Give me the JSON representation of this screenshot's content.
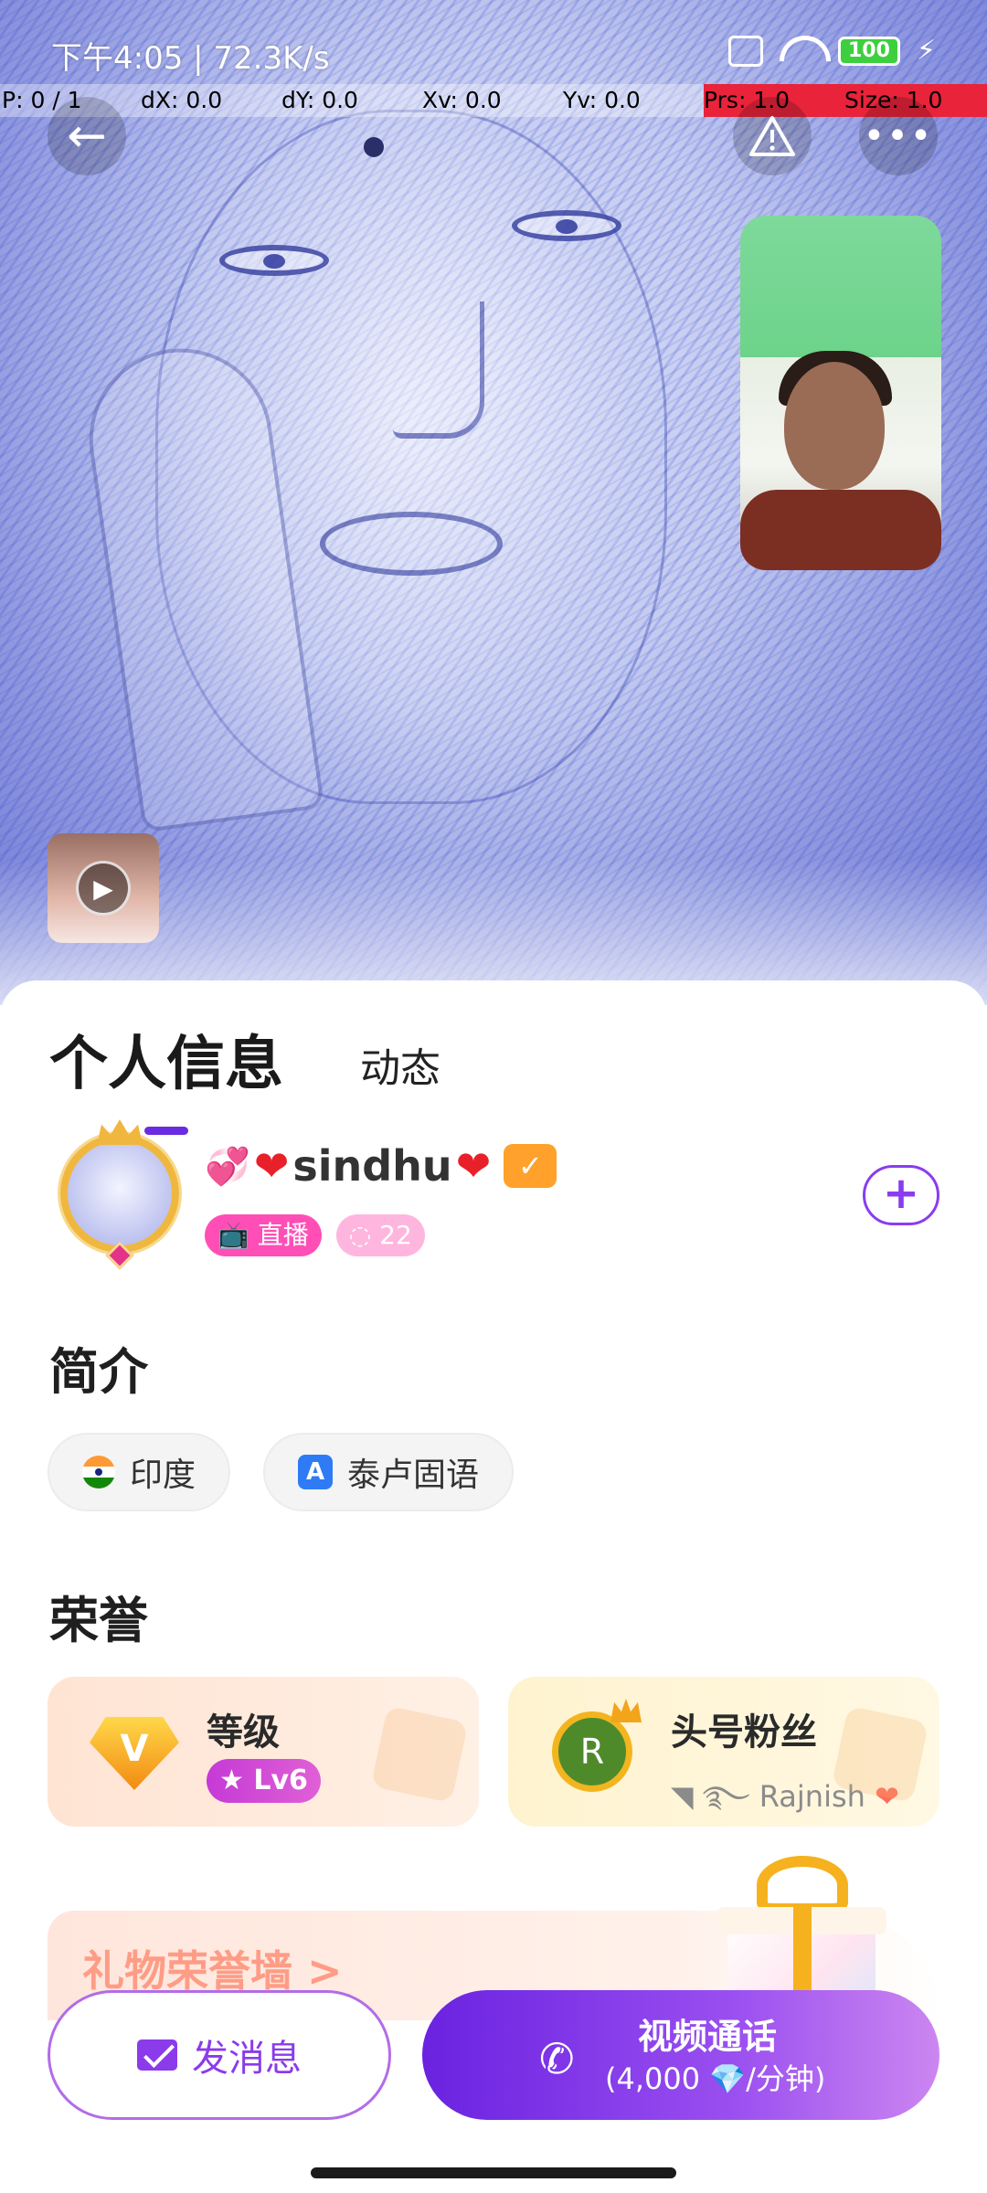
{
  "status_bar": {
    "time_speed": "下午4:05 | 72.3K/s",
    "battery": "100"
  },
  "debug": {
    "p": "P: 0 / 1",
    "dx": "dX: 0.0",
    "dy": "dY: 0.0",
    "xv": "Xv: 0.0",
    "yv": "Yv: 0.0",
    "prs": "Prs: 1.0",
    "size": "Size: 1.0"
  },
  "nav": {
    "back_icon": "back-arrow-icon",
    "warning_icon": "warning-icon",
    "more_icon": "more-dots-icon"
  },
  "tabs": [
    {
      "label": "个人信息",
      "active": true
    },
    {
      "label": "动态",
      "active": false
    }
  ],
  "profile": {
    "username": "sindhu",
    "live_badge": "直播",
    "fans_count": "22"
  },
  "intro": {
    "title": "简介",
    "country": "印度",
    "language": "泰卢固语"
  },
  "honor": {
    "title": "荣誉",
    "level_label": "等级",
    "level_value": "Lv6",
    "top_fan_label": "头号粉丝",
    "top_fan_avatar": "R",
    "top_fan_name": "Rajnish"
  },
  "gift_wall": {
    "title": "礼物荣誉墙 >"
  },
  "actions": {
    "message_label": "发消息",
    "call_label": "视频通话",
    "call_price": "(4,000 💎/分钟)"
  },
  "colors": {
    "accent": "#6a2ce0",
    "live_pink": "#ff4fb6"
  }
}
